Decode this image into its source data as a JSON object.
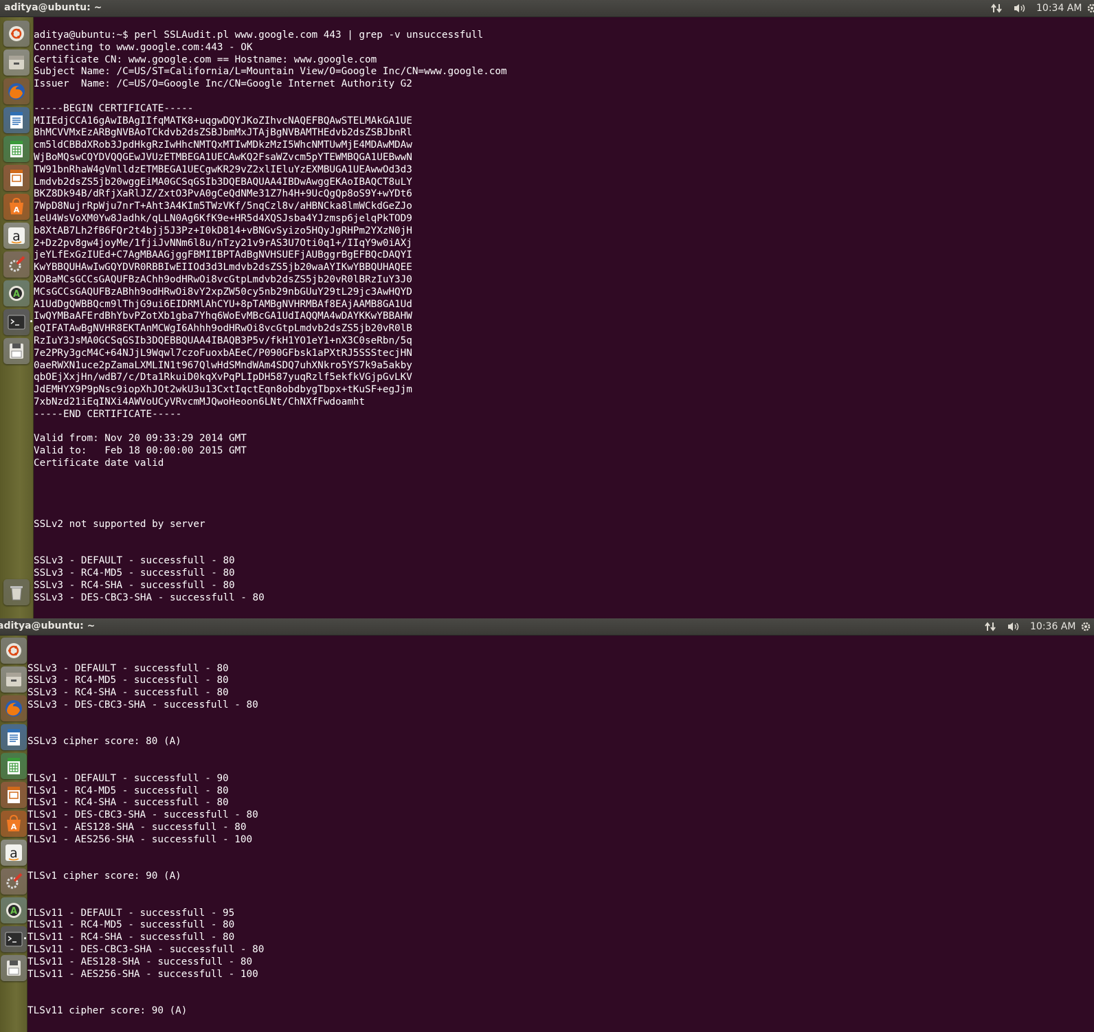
{
  "screen1": {
    "window_title": "aditya@ubuntu: ~",
    "clock": "10:34 AM",
    "terminal": {
      "lines": [
        "aditya@ubuntu:~$ perl SSLAudit.pl www.google.com 443 | grep -v unsuccessfull",
        "Connecting to www.google.com:443 - OK",
        "Certificate CN: www.google.com == Hostname: www.google.com",
        "Subject Name: /C=US/ST=California/L=Mountain View/O=Google Inc/CN=www.google.com",
        "Issuer  Name: /C=US/O=Google Inc/CN=Google Internet Authority G2",
        "",
        "-----BEGIN CERTIFICATE-----",
        "MIIEdjCCA16gAwIBAgIIfqMATK8+uqgwDQYJKoZIhvcNAQEFBQAwSTELMAkGA1UE",
        "BhMCVVMxEzARBgNVBAoTCkdvb2dsZSBJbmMxJTAjBgNVBAMTHEdvb2dsZSBJbnRl",
        "cm5ldCBBdXRob3JpdHkgRzIwHhcNMTQxMTIwMDkzMzI5WhcNMTUwMjE4MDAwMDAw",
        "WjBoMQswCQYDVQQGEwJVUzETMBEGA1UECAwKQ2FsaWZvcm5pYTEWMBQGA1UEBwwN",
        "TW91bnRhaW4gVmlldzETMBEGA1UECgwKR29vZ2xlIEluYzEXMBUGA1UEAwwOd3d3",
        "Lmdvb2dsZS5jb20wggEiMA0GCSqGSIb3DQEBAQUAA4IBDwAwggEKAoIBAQCT8uLY",
        "BKZ8Dk94B/dRfjXaRlJZ/ZxtO3PvA0gCeQdNMe31Z7h4H+9UcQgQp8oS9Y+wYDt6",
        "7WpD8NujrRpWju7nrT+Aht3A4KIm5TWzVKf/5nqCzl8v/aHBNCka8lmWCkdGeZJo",
        "1eU4WsVoXM0Yw8Jadhk/qLLN0Ag6KfK9e+HR5d4XQSJsba4YJzmsp6jelqPkTOD9",
        "b8XtAB7Lh2fB6FQr2t4bjj5J3Pz+I0kD814+vBNGvSyizo5HQyJgRHPm2YXzN0jH",
        "2+Dz2pv8gw4joyMe/1fjiJvNNm6l8u/nTzy21v9rAS3U7Oti0q1+/IIqY9w0iAXj",
        "jeYLfExGzIUEd+C7AgMBAAGjggFBMIIBPTAdBgNVHSUEFjAUBggrBgEFBQcDAQYI",
        "KwYBBQUHAwIwGQYDVR0RBBIwEIIOd3d3Lmdvb2dsZS5jb20waAYIKwYBBQUHAQEE",
        "XDBaMCsGCCsGAQUFBzAChh9odHRwOi8vcGtpLmdvb2dsZS5jb20vR0lBRzIuY3J0",
        "MCsGCCsGAQUFBzABhh9odHRwOi8vY2xpZW50cy5nb29nbGUuY29tL29jc3AwHQYD",
        "A1UdDgQWBBQcm9lThjG9ui6EIDRMlAhCYU+8pTAMBgNVHRMBAf8EAjAAMB8GA1Ud",
        "IwQYMBaAFErdBhYbvPZotXb1gba7Yhq6WoEvMBcGA1UdIAQQMA4wDAYKKwYBBAHW",
        "eQIFATAwBgNVHR8EKTAnMCWgI6Ahhh9odHRwOi8vcGtpLmdvb2dsZS5jb20vR0lB",
        "RzIuY3JsMA0GCSqGSIb3DQEBBQUAA4IBAQB3P5v/fkH1YO1eY1+nX3C0seRbn/5q",
        "7e2PRy3gcM4C+64NJjL9Wqwl7czoFuoxbAEeC/P090GFbsk1aPXtRJ5SSStecjHN",
        "0aeRWXN1uce2pZamaLXMLIN1t967QlwHdSMndWAm4SDQ7uhXNkro5YS7k9a5akby",
        "qbOEjXxjHn/wdB7/c/Dta1RkuiD0kqXvPqPLIpDH587yuqRzlf5ekfkVGjpGvLKV",
        "JdEMHYX9P9pNsc9iopXhJOt2wkU3u13CxtIqctEqn8obdbygTbpx+tKuSF+egJjm",
        "7xbNzd21iEqINXi4AWVoUCyVRvcmMJQwoHeoon6LNt/ChNXfFwdoamht",
        "-----END CERTIFICATE-----",
        "",
        "Valid from: Nov 20 09:33:29 2014 GMT",
        "Valid to:   Feb 18 00:00:00 2015 GMT",
        "Certificate date valid",
        "",
        "",
        "",
        "",
        "SSLv2 not supported by server",
        "",
        "",
        "SSLv3 - DEFAULT - successfull - 80",
        "SSLv3 - RC4-MD5 - successfull - 80",
        "SSLv3 - RC4-SHA - successfull - 80",
        "SSLv3 - DES-CBC3-SHA - successfull - 80"
      ]
    }
  },
  "screen2": {
    "window_title": "aditya@ubuntu: ~",
    "clock": "10:36 AM",
    "terminal": {
      "lines": [
        "",
        "",
        "SSLv3 - DEFAULT - successfull - 80",
        "SSLv3 - RC4-MD5 - successfull - 80",
        "SSLv3 - RC4-SHA - successfull - 80",
        "SSLv3 - DES-CBC3-SHA - successfull - 80",
        "",
        "",
        "SSLv3 cipher score: 80 (A)",
        "",
        "",
        "TLSv1 - DEFAULT - successfull - 90",
        "TLSv1 - RC4-MD5 - successfull - 80",
        "TLSv1 - RC4-SHA - successfull - 80",
        "TLSv1 - DES-CBC3-SHA - successfull - 80",
        "TLSv1 - AES128-SHA - successfull - 80",
        "TLSv1 - AES256-SHA - successfull - 100",
        "",
        "",
        "TLSv1 cipher score: 90 (A)",
        "",
        "",
        "TLSv11 - DEFAULT - successfull - 95",
        "TLSv11 - RC4-MD5 - successfull - 80",
        "TLSv11 - RC4-SHA - successfull - 80",
        "TLSv11 - DES-CBC3-SHA - successfull - 80",
        "TLSv11 - AES128-SHA - successfull - 80",
        "TLSv11 - AES256-SHA - successfull - 100",
        "",
        "",
        "TLSv11 cipher score: 90 (A)"
      ]
    }
  },
  "launcher_icons": [
    "ubuntu-dash-icon",
    "file-manager-icon",
    "firefox-icon",
    "writer-icon",
    "calc-icon",
    "impress-icon",
    "software-center-icon",
    "amazon-icon",
    "system-settings-icon",
    "software-updater-icon",
    "terminal-icon",
    "save-disk-icon",
    "trash-icon"
  ],
  "colors": {
    "terminal_bg": "#300a24",
    "terminal_fg": "#ffffff",
    "panel_bg": "#3c3b37",
    "launcher_bg": "#66652f"
  }
}
